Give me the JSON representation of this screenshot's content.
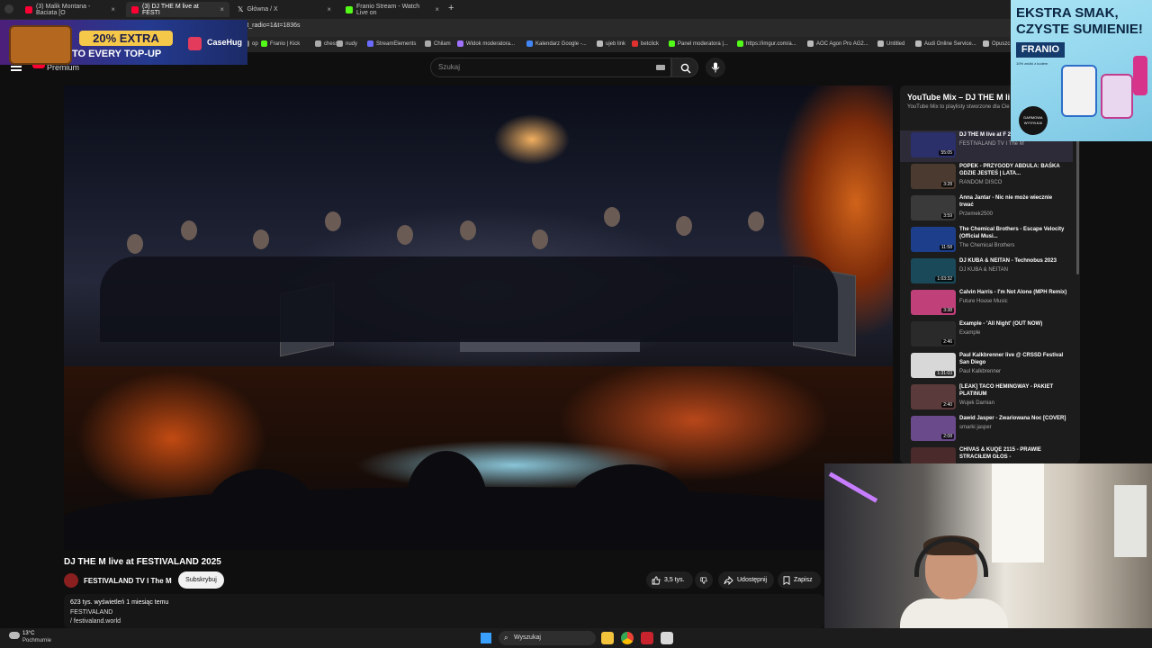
{
  "browser": {
    "tabs": [
      {
        "title": "(3) Malik Montana - Baciata [O",
        "active": false,
        "color": "#ff0033"
      },
      {
        "title": "(3) DJ THE M live at FESTI",
        "active": true,
        "color": "#ff0033"
      },
      {
        "title": "Główna / X",
        "active": false,
        "color": "#000000"
      },
      {
        "title": "Franio Stream - Watch Live on",
        "active": false,
        "color": "#53fc18"
      }
    ],
    "url": "rt_radio=1&t=1836s",
    "bookmarks": [
      "op",
      "Franio | Kick",
      "chess",
      "nudy",
      "StreamElements",
      "Chilam",
      "Widok moderatora...",
      "Kalendarz Google -...",
      "ujeb link",
      "betclick",
      "Panel moderatora |...",
      "https://imgur.com/a...",
      "AOC Agon Pro AG2...",
      "Untitled",
      "Audi Online Service...",
      "Opuszc"
    ]
  },
  "header": {
    "logo_suffix": "Premium",
    "search_placeholder": "Szukaj"
  },
  "video": {
    "title": "DJ THE M live at FESTIVALAND 2025",
    "channel": "FESTIVALAND TV I The M",
    "subscribe_label": "Subskrybuj",
    "likes": "3,5 tys.",
    "share_label": "Udostępnij",
    "save_label": "Zapisz",
    "views_line": "623 tys. wyświetleń  1 miesiąc temu",
    "desc_line": "FESTIVALAND",
    "desc_link": "/ festivaland.world"
  },
  "playlist": {
    "title": "YouTube Mix – DJ THE M li",
    "subtitle": "YouTube Mix to playlisty stworzone dla Cie",
    "items": [
      {
        "title": "DJ THE M live at F 2025",
        "channel": "FESTIVALAND TV I The M",
        "duration": "55:05",
        "thumb": "#2b2f6a"
      },
      {
        "title": "POPEK - PRZYGODY ABDULA: BAŚKA GDZIE JESTEŚ | LATA...",
        "channel": "RANDOM DISCO",
        "duration": "3:28",
        "thumb": "#4a3a30"
      },
      {
        "title": "Anna Jantar - Nic nie może wiecznie trwać",
        "channel": "Przemek2500",
        "duration": "3:59",
        "thumb": "#3a3a3a"
      },
      {
        "title": "The Chemical Brothers - Escape Velocity (Official Musi...",
        "channel": "The Chemical Brothers",
        "duration": "11:58",
        "thumb": "#1d3e8a"
      },
      {
        "title": "DJ KUBA & NEITAN - Technobus 2023",
        "channel": "DJ KUBA & NEITAN",
        "duration": "1:03:32",
        "thumb": "#1a4a5a"
      },
      {
        "title": "Calvin Harris - I'm Not Alone (MPH Remix)",
        "channel": "Future House Music",
        "duration": "3:38",
        "thumb": "#c0407a"
      },
      {
        "title": "Example - 'All Night' (OUT NOW)",
        "channel": "Example",
        "duration": "2:46",
        "thumb": "#2a2a2a"
      },
      {
        "title": "Paul Kalkbrenner live @ CRSSD Festival San Diego",
        "channel": "Paul Kalkbrenner",
        "duration": "1:31:03",
        "thumb": "#d8d8d8"
      },
      {
        "title": "[LEAK] TACO HEMINGWAY - PAKIET PLATINUM",
        "channel": "Wujek Damian",
        "duration": "2:40",
        "thumb": "#5a3a3a"
      },
      {
        "title": "Dawid Jasper - Zwariowana Noc [COVER]",
        "channel": "smarki jasper",
        "duration": "2:08",
        "thumb": "#6a4a8a"
      },
      {
        "title": "CHIVAS & KUQE 2115 - PRAWIE STRACIŁEM GŁOS -",
        "channel": "",
        "duration": "",
        "thumb": "#4a2a2a"
      }
    ]
  },
  "ads": {
    "left_badge": "20% EXTRA",
    "left_line2": "TO EVERY TOP-UP",
    "left_brand": "CaseHug",
    "right_line1": "EKSTRA SMAK,",
    "right_line2": "CZYSTE SUMIENIE!",
    "right_brand": "FRANIO",
    "right_sub": "10% zniżki z kodem",
    "right_circle": "DARMOWA WYSYŁKA!"
  },
  "taskbar": {
    "temperature": "13°C",
    "weather": "Pochmurnie",
    "search_label": "Wyszukaj"
  }
}
